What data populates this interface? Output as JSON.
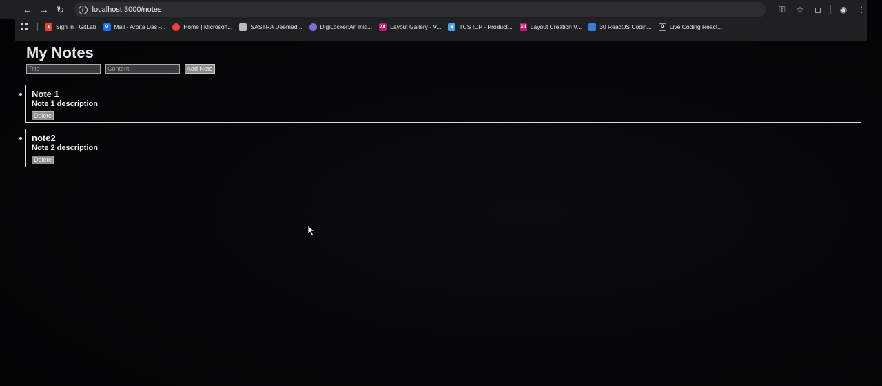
{
  "browser": {
    "url": "localhost:3000/notes",
    "bookmarks": [
      {
        "label": "Sign in · GitLab",
        "icon": "gitlab-icon",
        "color": "#e2432a"
      },
      {
        "label": "Mail - Arpita Das -...",
        "icon": "outlook-icon",
        "color": "#1a73e8"
      },
      {
        "label": "Home | Microsoft...",
        "icon": "microsoft-icon",
        "color": "#ea4335"
      },
      {
        "label": "SASTRA Deemed...",
        "icon": "page-icon",
        "color": "#bbbbbb"
      },
      {
        "label": "DigiLocker:An Initi...",
        "icon": "cloud-icon",
        "color": "#7b6fd0"
      },
      {
        "label": "Layout Gallery - V...",
        "icon": "xd-icon",
        "color": "#c4126f"
      },
      {
        "label": "TCS IDP - Product...",
        "icon": "puzzle-icon",
        "color": "#4aa3e8"
      },
      {
        "label": "Layout Creation V...",
        "icon": "xd-icon",
        "color": "#c4126f"
      },
      {
        "label": "30 ReactJS Codin...",
        "icon": "page-icon",
        "color": "#3b7dd8"
      },
      {
        "label": "Live Coding React...",
        "icon": "dev-icon",
        "color": "#222222"
      }
    ]
  },
  "page": {
    "title": "My Notes",
    "form": {
      "title_placeholder": "Title",
      "content_placeholder": "Content",
      "add_label": "Add Note"
    },
    "notes": [
      {
        "title": "Note 1",
        "description": "Note 1 description",
        "delete_label": "Delete"
      },
      {
        "title": "note2",
        "description": "Note 2 description",
        "delete_label": "Delete"
      }
    ]
  }
}
